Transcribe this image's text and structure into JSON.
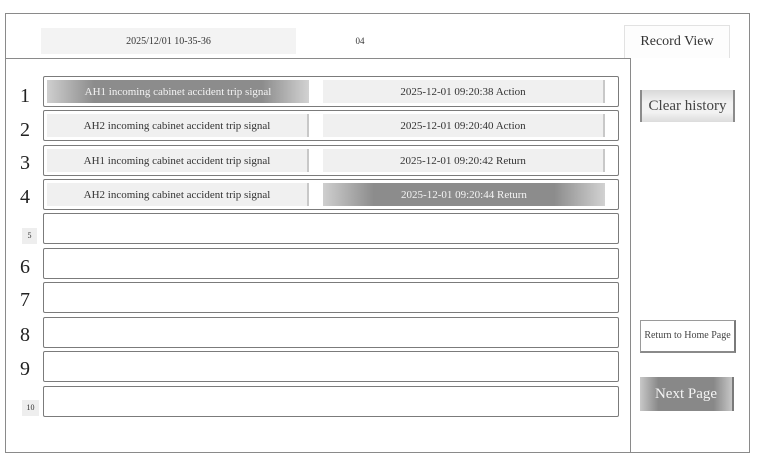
{
  "header": {
    "datetime": "2025/12/01 10-35-36",
    "page_number": "04",
    "view_tab": "Record View"
  },
  "records": [
    {
      "index": "1",
      "signal": "AH1 incoming cabinet accident trip signal",
      "time_status": "2025-12-01 09:20:38 Action",
      "signal_highlighted": true,
      "time_highlighted": false
    },
    {
      "index": "2",
      "signal": "AH2 incoming cabinet accident trip signal",
      "time_status": "2025-12-01 09:20:40 Action",
      "signal_highlighted": false,
      "time_highlighted": false
    },
    {
      "index": "3",
      "signal": "AH1 incoming cabinet accident trip signal",
      "time_status": "2025-12-01 09:20:42 Return",
      "signal_highlighted": false,
      "time_highlighted": false
    },
    {
      "index": "4",
      "signal": "AH2 incoming cabinet accident trip signal",
      "time_status": "2025-12-01 09:20:44 Return",
      "signal_highlighted": false,
      "time_highlighted": true
    },
    {
      "index": "5",
      "signal": "",
      "time_status": ""
    },
    {
      "index": "6",
      "signal": "",
      "time_status": ""
    },
    {
      "index": "7",
      "signal": "",
      "time_status": ""
    },
    {
      "index": "8",
      "signal": "",
      "time_status": ""
    },
    {
      "index": "9",
      "signal": "",
      "time_status": ""
    },
    {
      "index": "10",
      "signal": "",
      "time_status": ""
    }
  ],
  "sidebar": {
    "clear_history": "Clear history",
    "return_home": "Return to Home Page",
    "next_page": "Next Page"
  }
}
